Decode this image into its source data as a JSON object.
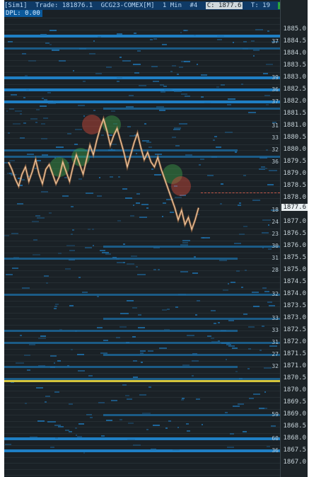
{
  "header": {
    "mode": "[Sim1]",
    "trade": "Trade: 181876.1",
    "symbol": "GCG23-COMEX[M]",
    "interval": "1 Min",
    "index": "#4",
    "close": "C: 1877.6",
    "time_label": "T: 19",
    "status_badge": "Ok"
  },
  "pnl": "DPL: 0.00",
  "price_axis": {
    "ticks": [
      "1885.0",
      "1884.5",
      "1884.0",
      "1883.5",
      "1883.0",
      "1882.5",
      "1882.0",
      "1881.5",
      "1881.0",
      "1880.5",
      "1880.0",
      "1879.5",
      "1879.0",
      "1878.5",
      "1878.0",
      "1877.5",
      "1877.0",
      "1876.5",
      "1876.0",
      "1875.5",
      "1875.0",
      "1874.5",
      "1874.0",
      "1873.5",
      "1873.0",
      "1872.5",
      "1872.0",
      "1871.5",
      "1871.0",
      "1870.5",
      "1870.0",
      "1869.5",
      "1869.0",
      "1868.5",
      "1868.0",
      "1867.5",
      "1867.0"
    ],
    "current": "1877.6"
  },
  "depth_volumes": [
    {
      "price": "1884.5",
      "vol": "37"
    },
    {
      "price": "1883.0",
      "vol": "39"
    },
    {
      "price": "1882.5",
      "vol": "36"
    },
    {
      "price": "1882.0",
      "vol": "37"
    },
    {
      "price": "1881.0",
      "vol": "31"
    },
    {
      "price": "1880.5",
      "vol": "33"
    },
    {
      "price": "1880.0",
      "vol": "32"
    },
    {
      "price": "1879.5",
      "vol": "36"
    },
    {
      "price": "1877.5",
      "vol": "18"
    },
    {
      "price": "1877.0",
      "vol": "24"
    },
    {
      "price": "1876.5",
      "vol": "23"
    },
    {
      "price": "1876.0",
      "vol": "30"
    },
    {
      "price": "1875.5",
      "vol": "31"
    },
    {
      "price": "1875.0",
      "vol": "28"
    },
    {
      "price": "1874.0",
      "vol": "32"
    },
    {
      "price": "1873.0",
      "vol": "33"
    },
    {
      "price": "1872.5",
      "vol": "33"
    },
    {
      "price": "1872.0",
      "vol": "31"
    },
    {
      "price": "1871.5",
      "vol": "27"
    },
    {
      "price": "1871.0",
      "vol": "32"
    },
    {
      "price": "1869.0",
      "vol": "59"
    },
    {
      "price": "1868.0",
      "vol": "60"
    },
    {
      "price": "1867.5",
      "vol": "36"
    }
  ],
  "price_series": [
    1879.5,
    1879.2,
    1878.8,
    1878.5,
    1879.0,
    1879.3,
    1878.7,
    1879.1,
    1879.6,
    1879.0,
    1878.6,
    1879.2,
    1879.4,
    1879.0,
    1878.6,
    1878.9,
    1879.5,
    1879.1,
    1878.7,
    1879.3,
    1879.8,
    1879.4,
    1879.0,
    1879.6,
    1880.2,
    1879.8,
    1880.4,
    1880.9,
    1881.3,
    1880.8,
    1880.2,
    1880.6,
    1880.9,
    1880.4,
    1879.9,
    1879.3,
    1879.8,
    1880.3,
    1880.7,
    1880.1,
    1879.6,
    1879.9,
    1879.5,
    1879.3,
    1879.7,
    1879.2,
    1878.8,
    1878.4,
    1878.0,
    1877.6,
    1877.1,
    1877.5,
    1876.9,
    1877.2,
    1876.7,
    1877.1,
    1877.6
  ]
}
